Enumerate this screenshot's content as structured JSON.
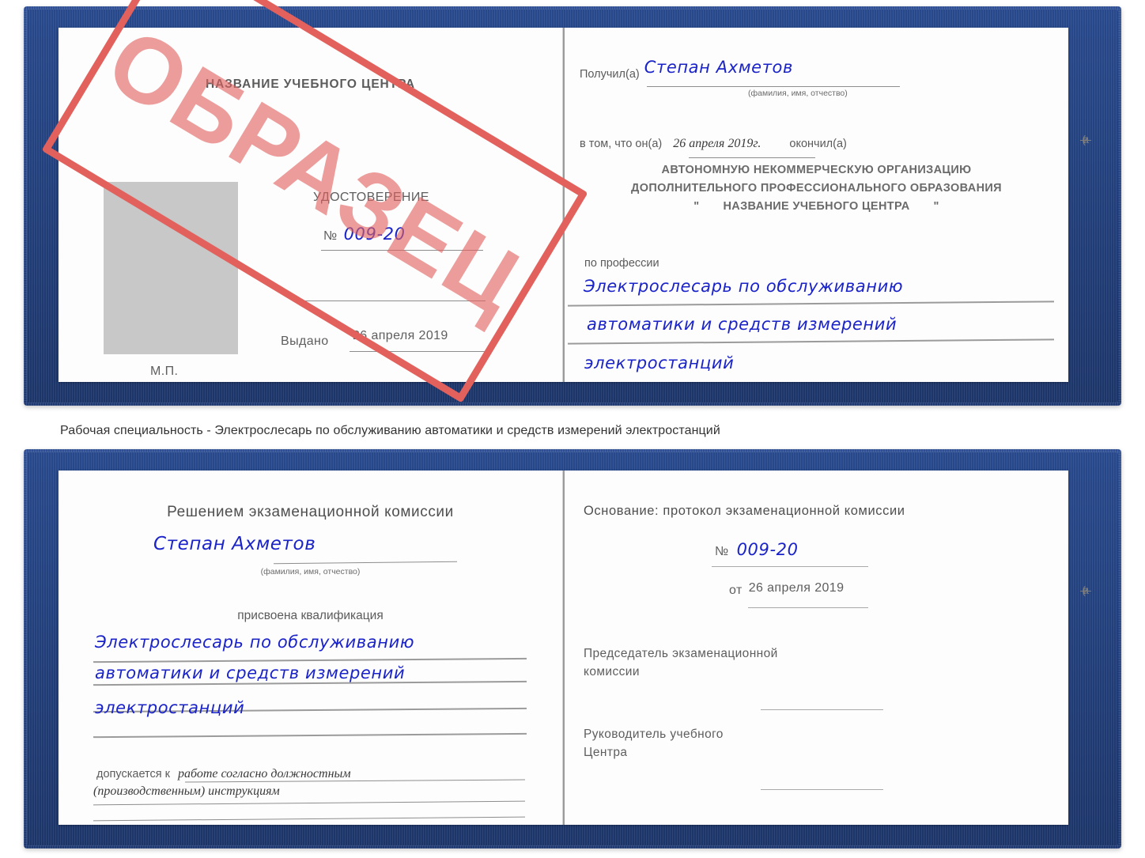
{
  "caption": "Рабочая специальность - Электрослесарь по обслуживанию автоматики и средств измерений электростанций",
  "watermark": {
    "text": "ОБРАЗЕЦ",
    "color": "#e2615d"
  },
  "colors": {
    "cover": "#27488b",
    "ink": "#1a23c8",
    "page": "#fdfdfd",
    "rule": "#8d8d8d"
  },
  "certificate_top": {
    "left_page": {
      "center_name": "НАЗВАНИЕ УЧЕБНОГО ЦЕНТРА",
      "doc_title": "УДОСТОВЕРЕНИЕ",
      "number_label": "№",
      "number_value": "009-20",
      "issued_label": "Выдано",
      "issued_value": "26 апреля 2019",
      "seal_label": "М.П."
    },
    "right_page": {
      "received_label": "Получил(а)",
      "received_value": "Степан Ахметов",
      "fio_hint": "(фамилия, имя, отчество)",
      "that_he_label": "в том, что он(а)",
      "that_he_value": "26 апреля 2019г.",
      "finished_label": "окончил(а)",
      "org_line1": "АВТОНОМНУЮ НЕКОММЕРЧЕСКУЮ ОРГАНИЗАЦИЮ",
      "org_line2": "ДОПОЛНИТЕЛЬНОГО ПРОФЕССИОНАЛЬНОГО ОБРАЗОВАНИЯ",
      "org_quote_open": "\"",
      "org_line3": "НАЗВАНИЕ УЧЕБНОГО ЦЕНТРА",
      "org_quote_close": "\"",
      "profession_label": "по профессии",
      "profession_line1": "Электрослесарь по обслуживанию",
      "profession_line2": "автоматики и средств измерений",
      "profession_line3": "электростанций",
      "edge_marks": [
        "—",
        "—",
        "—",
        "и",
        "а",
        "(-",
        "—",
        "—",
        "—",
        "—"
      ]
    }
  },
  "certificate_bottom": {
    "left_page": {
      "title": "Решением экзаменационной комиссии",
      "name_value": "Степан Ахметов",
      "fio_hint": "(фамилия, имя, отчество)",
      "qualification_label": "присвоена квалификация",
      "qualification_line1": "Электрослесарь по обслуживанию",
      "qualification_line2": "автоматики и средств измерений",
      "qualification_line3": "электростанций",
      "allowed_label": "допускается к",
      "allowed_line1": "работе согласно должностным",
      "allowed_line2": "(производственным) инструкциям"
    },
    "right_page": {
      "basis_label": "Основание: протокол экзаменационной комиссии",
      "number_label": "№",
      "number_value": "009-20",
      "date_label": "от",
      "date_value": "26 апреля 2019",
      "chairman_line1": "Председатель экзаменационной",
      "chairman_line2": "комиссии",
      "head_line1": "Руководитель учебного",
      "head_line2": "Центра",
      "edge_marks": [
        "—",
        "—",
        "—",
        "и",
        "а",
        "(-",
        "—",
        "—",
        "—",
        "—"
      ]
    }
  }
}
